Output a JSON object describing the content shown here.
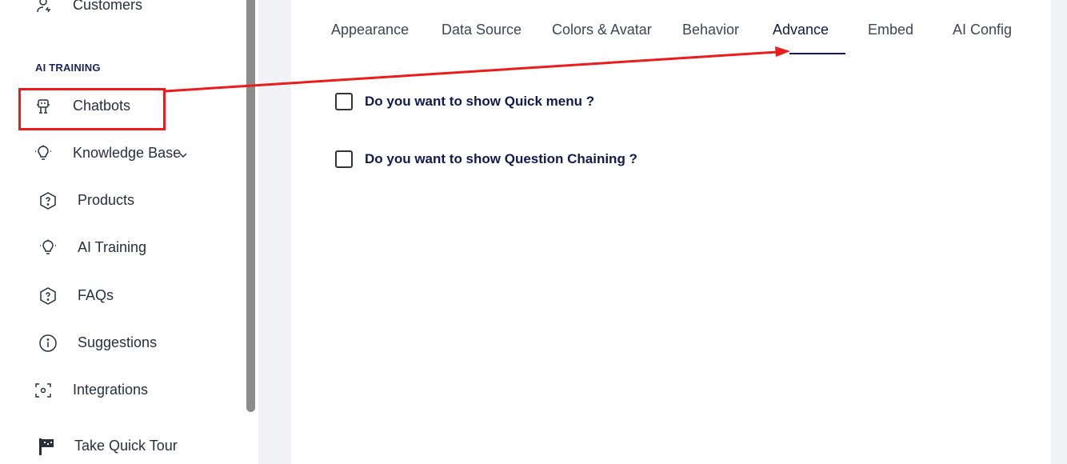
{
  "sidebar": {
    "section_title": "AI TRAINING",
    "items": {
      "customers": "Customers",
      "chatbots": "Chatbots",
      "knowledge_base": "Knowledge Base",
      "products": "Products",
      "ai_training": "AI Training",
      "faqs": "FAQs",
      "suggestions": "Suggestions",
      "integrations": "Integrations",
      "take_quick_tour": "Take Quick Tour"
    }
  },
  "tabs": {
    "appearance": "Appearance",
    "data_source": "Data Source",
    "colors_avatar": "Colors & Avatar",
    "behavior": "Behavior",
    "advance": "Advance",
    "embed": "Embed",
    "ai_config": "AI Config",
    "active": "advance"
  },
  "advance": {
    "quick_menu_label": "Do you want to show Quick menu ?",
    "question_chaining_label": "Do you want to show Question Chaining ?",
    "quick_menu_checked": false,
    "question_chaining_checked": false
  },
  "colors": {
    "accent": "#121a45",
    "annotation_red": "#ea1c1c"
  }
}
